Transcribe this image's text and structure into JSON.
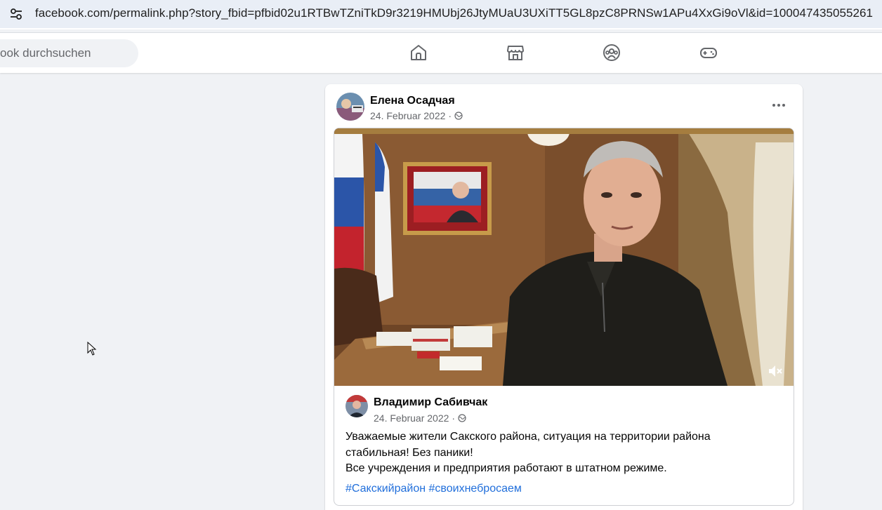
{
  "browser": {
    "url": "facebook.com/permalink.php?story_fbid=pfbid02u1RTBwTZniTkD9r3219HMUbj26JtyMUaU3UXiTT5GL8pzC8PRNSw1APu4XxGi9oVl&id=100047435055261",
    "site_info_icon": "tune-icon"
  },
  "nav": {
    "search_placeholder": "ook durchsuchen",
    "icons": [
      "home-icon",
      "marketplace-icon",
      "groups-icon",
      "gaming-icon"
    ]
  },
  "post": {
    "author": "Елена Осадчая",
    "date": "24. Februar 2022",
    "separator": "·",
    "audience_icon": "globe-icon",
    "more_icon": "more-options-icon",
    "shared": {
      "author": "Владимир Сабивчак",
      "date": "24. Februar 2022",
      "separator": "·",
      "text_line1": "Уважаемые жители Сакского района, ситуация на территории района",
      "text_line2": "стабильная! Без паники!",
      "text_line3": "Все учреждения и предприятия работают в штатном режиме.",
      "hashtags": [
        "#Сакскийрайон",
        "#своихнебросаем"
      ],
      "video_icon": "mute-icon"
    }
  },
  "colors": {
    "link": "#216fdb",
    "secondary_text": "#65676b",
    "page_bg": "#f0f2f5"
  }
}
